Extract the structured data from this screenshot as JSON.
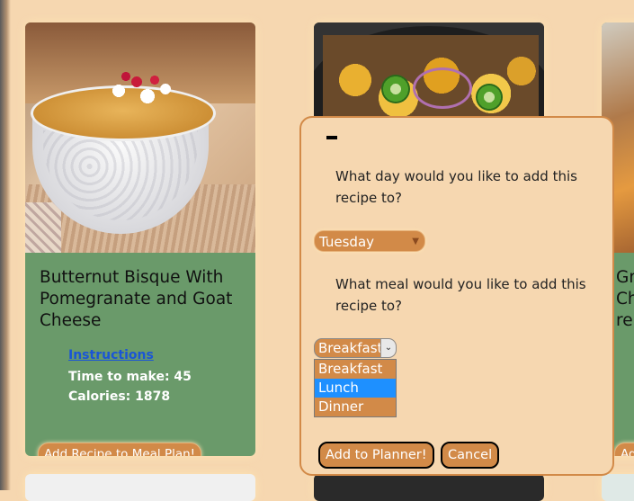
{
  "cards": {
    "first": {
      "title": "Butternut Bisque With Pomegranate and Goat Cheese",
      "instructions_link": "Instructions",
      "time_to_make": "Time to make: 45",
      "calories": "Calories: 1878",
      "add_button": "Add Recipe to Meal Plan!"
    },
    "third": {
      "title_partial": "Gr\nCh\nre",
      "add_button_partial": "Ad"
    }
  },
  "modal": {
    "day_question": "What day would you like to add this recipe to?",
    "day_selected": "Tuesday",
    "meal_question": "What meal would you like to add this recipe to?",
    "meal_selected": "Breakfast",
    "meal_options": [
      "Breakfast",
      "Lunch",
      "Dinner"
    ],
    "highlighted_option": "Lunch",
    "add_button": "Add to Planner!",
    "cancel_button": "Cancel"
  },
  "colors": {
    "page_bg": "#f6d7b0",
    "card_green": "#6a9a6a",
    "accent_orange": "#d28a48",
    "link_blue": "#1a55d6",
    "highlight_blue": "#1e90ff"
  }
}
